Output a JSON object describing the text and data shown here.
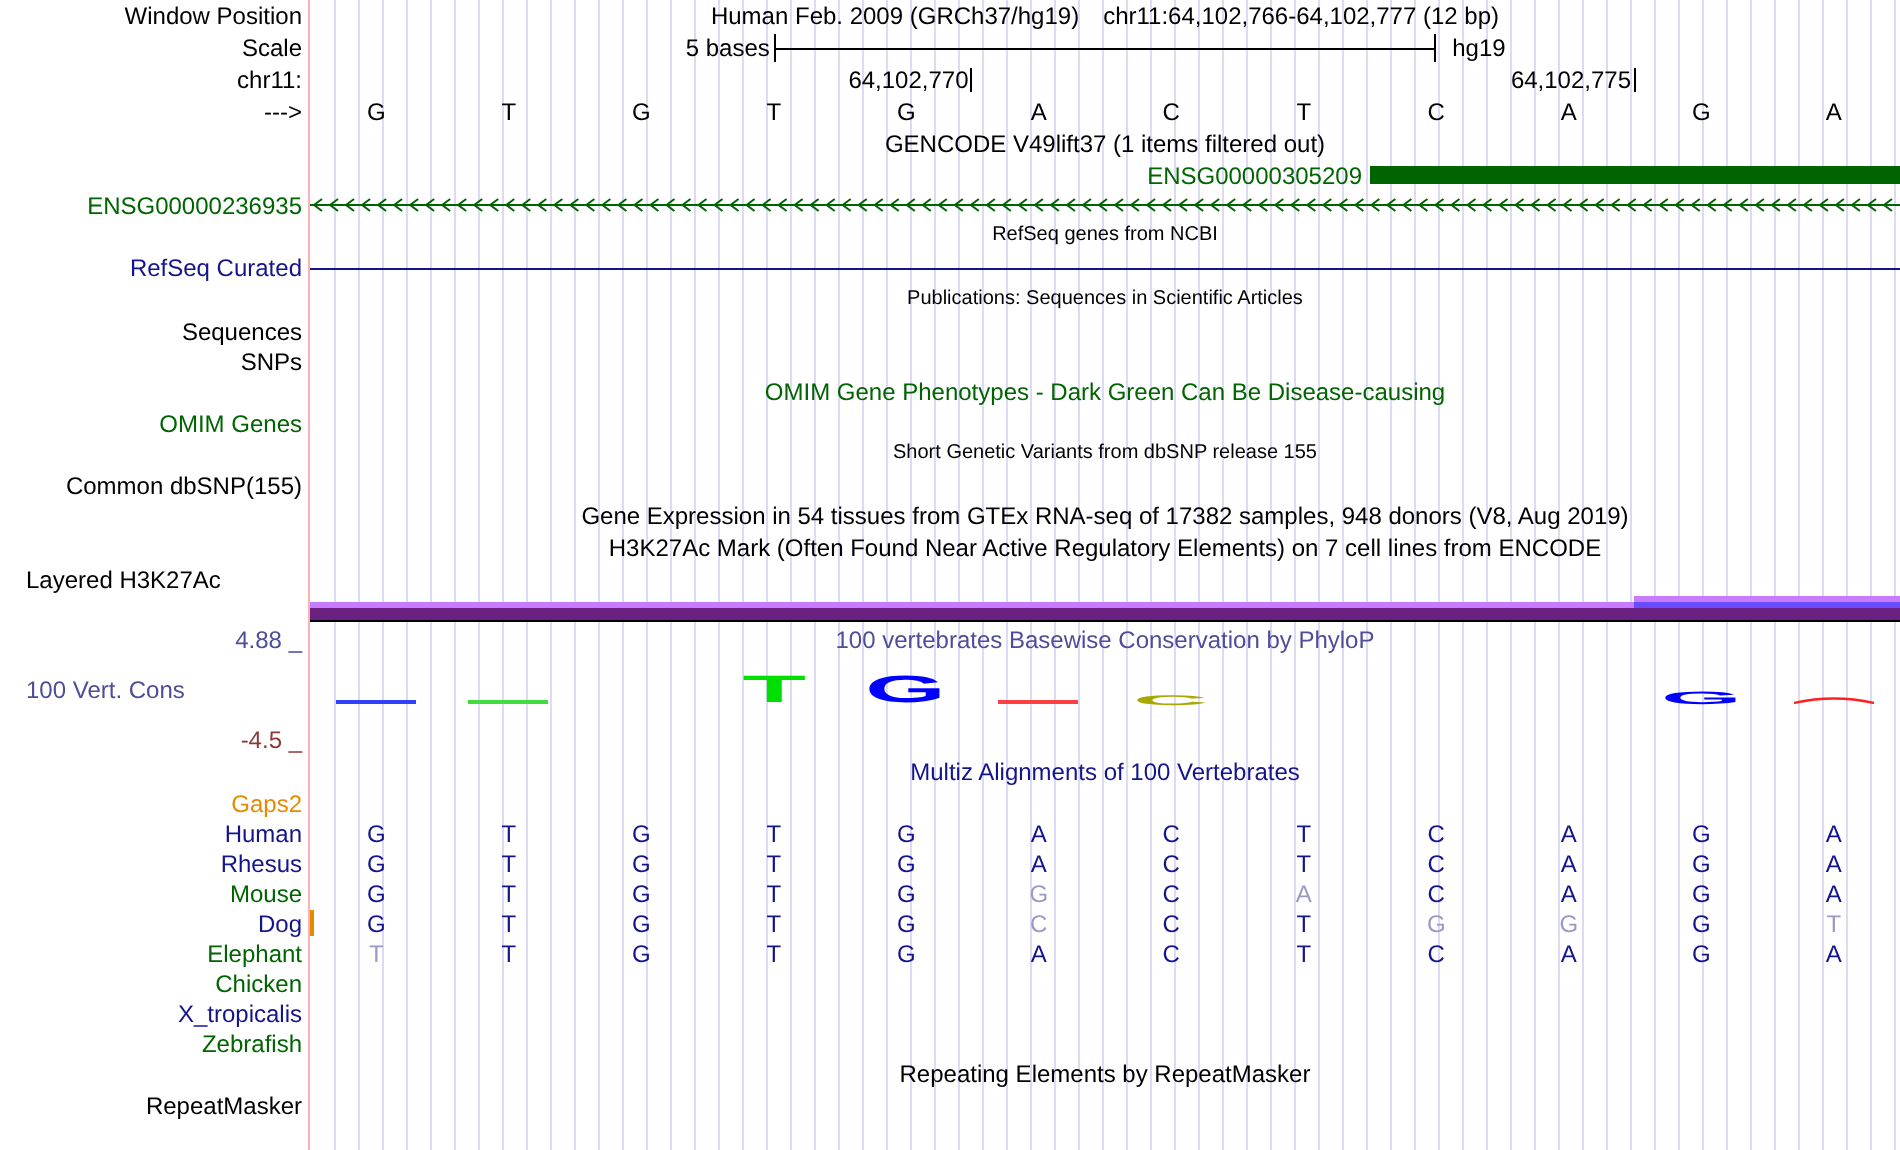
{
  "header": {
    "label": "Window Position",
    "assembly": "Human Feb. 2009 (GRCh37/hg19)",
    "position": "chr11:64,102,766-64,102,777 (12 bp)"
  },
  "scale": {
    "label": "Scale",
    "size": "5 bases",
    "assembly": "hg19"
  },
  "coordinates": {
    "label": "chr11:",
    "ticks": [
      "64,102,770",
      "64,102,775"
    ]
  },
  "sequence": {
    "label": "--->",
    "bases": [
      "G",
      "T",
      "G",
      "T",
      "G",
      "A",
      "C",
      "T",
      "C",
      "A",
      "G",
      "A"
    ]
  },
  "tracks": [
    {
      "kind": "title",
      "text": "GENCODE V49lift37 (1 items filtered out)"
    },
    {
      "kind": "gene-bar",
      "text": "ENSG00000305209",
      "color": "#006400"
    },
    {
      "kind": "gene-arrows",
      "label": "ENSG00000236935",
      "color": "#006400"
    },
    {
      "kind": "note",
      "text": "RefSeq genes from NCBI"
    },
    {
      "kind": "gene-line",
      "label": "RefSeq Curated",
      "color": "#14148c"
    },
    {
      "kind": "note",
      "text": "Publications: Sequences in Scientific Articles"
    },
    {
      "kind": "empty",
      "label": "Sequences"
    },
    {
      "kind": "empty",
      "label": "SNPs"
    },
    {
      "kind": "title",
      "text": "OMIM Gene Phenotypes - Dark Green Can Be Disease-causing",
      "color": "#006400"
    },
    {
      "kind": "empty",
      "label": "OMIM Genes",
      "color": "#006400"
    },
    {
      "kind": "note",
      "text": "Short Genetic Variants from dbSNP release 155"
    },
    {
      "kind": "empty",
      "label": "Common dbSNP(155)"
    },
    {
      "kind": "title",
      "text": "Gene Expression in 54 tissues from GTEx RNA-seq of 17382 samples, 948 donors (V8, Aug 2019)"
    },
    {
      "kind": "title",
      "text": "H3K27Ac Mark (Often Found Near Active Regulatory Elements) on 7 cell lines from ENCODE"
    },
    {
      "kind": "left-label",
      "label": "Layered H3K27Ac"
    },
    {
      "kind": "signal-bar"
    },
    {
      "kind": "conservation",
      "title": "100 vertebrates Basewise Conservation by PhyloP",
      "label": "100 Vert. Cons",
      "max": "4.88 _",
      "min": "-4.5 _",
      "logo": [
        {
          "kind": "flat",
          "color": "#3040ff"
        },
        {
          "kind": "flat",
          "color": "#40dd40"
        },
        {
          "kind": "none"
        },
        {
          "kind": "tall",
          "base": "T",
          "color": "#00e000"
        },
        {
          "kind": "tall",
          "base": "G",
          "color": "#0000ff"
        },
        {
          "kind": "flat",
          "color": "#ff4040"
        },
        {
          "kind": "short",
          "base": "C",
          "color": "#a8a800"
        },
        {
          "kind": "none"
        },
        {
          "kind": "none"
        },
        {
          "kind": "none"
        },
        {
          "kind": "medium",
          "base": "G",
          "color": "#0000ff"
        },
        {
          "kind": "arch",
          "color": "#ff2020"
        }
      ]
    },
    {
      "kind": "alignment",
      "title": "Multiz Alignments of 100 Vertebrates",
      "gaps_label": "Gaps2",
      "species": [
        {
          "name": "Human",
          "color": "#14148c",
          "gap_mark": false,
          "bases": [
            {
              "b": "G",
              "faded": false
            },
            {
              "b": "T",
              "faded": false
            },
            {
              "b": "G",
              "faded": false
            },
            {
              "b": "T",
              "faded": false
            },
            {
              "b": "G",
              "faded": false
            },
            {
              "b": "A",
              "faded": false
            },
            {
              "b": "C",
              "faded": false
            },
            {
              "b": "T",
              "faded": false
            },
            {
              "b": "C",
              "faded": false
            },
            {
              "b": "A",
              "faded": false
            },
            {
              "b": "G",
              "faded": false
            },
            {
              "b": "A",
              "faded": false
            }
          ]
        },
        {
          "name": "Rhesus",
          "color": "#14148c",
          "gap_mark": false,
          "bases": [
            {
              "b": "G",
              "faded": false
            },
            {
              "b": "T",
              "faded": false
            },
            {
              "b": "G",
              "faded": false
            },
            {
              "b": "T",
              "faded": false
            },
            {
              "b": "G",
              "faded": false
            },
            {
              "b": "A",
              "faded": false
            },
            {
              "b": "C",
              "faded": false
            },
            {
              "b": "T",
              "faded": false
            },
            {
              "b": "C",
              "faded": false
            },
            {
              "b": "A",
              "faded": false
            },
            {
              "b": "G",
              "faded": false
            },
            {
              "b": "A",
              "faded": false
            }
          ]
        },
        {
          "name": "Mouse",
          "color": "#006400",
          "gap_mark": false,
          "bases": [
            {
              "b": "G",
              "faded": false
            },
            {
              "b": "T",
              "faded": false
            },
            {
              "b": "G",
              "faded": false
            },
            {
              "b": "T",
              "faded": false
            },
            {
              "b": "G",
              "faded": false
            },
            {
              "b": "G",
              "faded": true
            },
            {
              "b": "C",
              "faded": false
            },
            {
              "b": "A",
              "faded": true
            },
            {
              "b": "C",
              "faded": false
            },
            {
              "b": "A",
              "faded": false
            },
            {
              "b": "G",
              "faded": false
            },
            {
              "b": "A",
              "faded": false
            }
          ]
        },
        {
          "name": "Dog",
          "color": "#14148c",
          "gap_mark": true,
          "bases": [
            {
              "b": "G",
              "faded": false
            },
            {
              "b": "T",
              "faded": false
            },
            {
              "b": "G",
              "faded": false
            },
            {
              "b": "T",
              "faded": false
            },
            {
              "b": "G",
              "faded": false
            },
            {
              "b": "C",
              "faded": true
            },
            {
              "b": "C",
              "faded": false
            },
            {
              "b": "T",
              "faded": false
            },
            {
              "b": "G",
              "faded": true
            },
            {
              "b": "G",
              "faded": true
            },
            {
              "b": "G",
              "faded": false
            },
            {
              "b": "T",
              "faded": true
            }
          ]
        },
        {
          "name": "Elephant",
          "color": "#006400",
          "gap_mark": false,
          "bases": [
            {
              "b": "T",
              "faded": true
            },
            {
              "b": "T",
              "faded": false
            },
            {
              "b": "G",
              "faded": false
            },
            {
              "b": "T",
              "faded": false
            },
            {
              "b": "G",
              "faded": false
            },
            {
              "b": "A",
              "faded": false
            },
            {
              "b": "C",
              "faded": false
            },
            {
              "b": "T",
              "faded": false
            },
            {
              "b": "C",
              "faded": false
            },
            {
              "b": "A",
              "faded": false
            },
            {
              "b": "G",
              "faded": false
            },
            {
              "b": "A",
              "faded": false
            }
          ]
        },
        {
          "name": "Chicken",
          "color": "#006400",
          "gap_mark": false
        },
        {
          "name": "X_tropicalis",
          "color": "#14148c",
          "gap_mark": false
        },
        {
          "name": "Zebrafish",
          "color": "#006400",
          "gap_mark": false
        }
      ]
    },
    {
      "kind": "title",
      "text": "Repeating Elements by RepeatMasker"
    },
    {
      "kind": "empty",
      "label": "RepeatMasker"
    }
  ]
}
